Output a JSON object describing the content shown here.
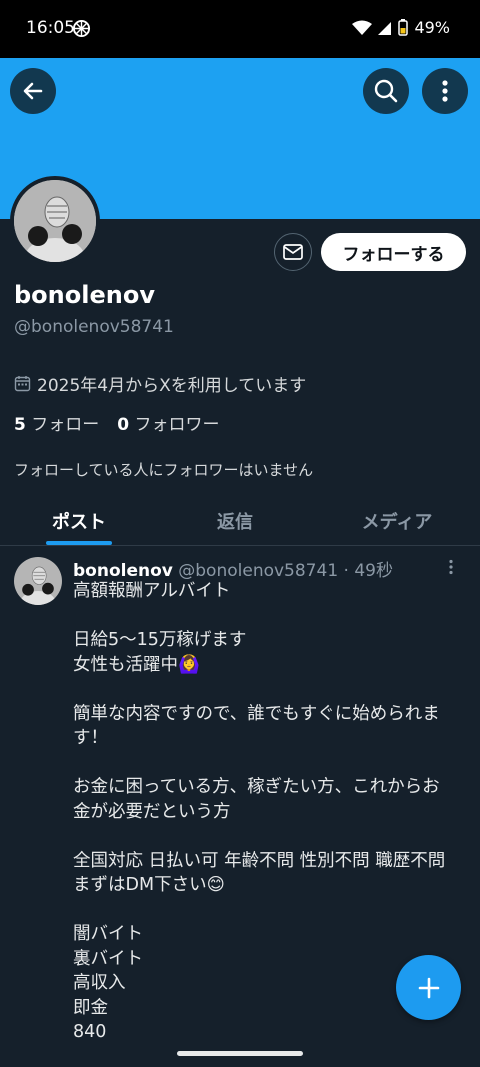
{
  "status_bar": {
    "time": "16:05",
    "battery": "49%"
  },
  "icons": {
    "back": "arrow-left-icon",
    "search": "search-icon",
    "more": "more-vertical-icon",
    "message": "envelope-icon",
    "calendar": "calendar-icon",
    "compose": "plus-icon"
  },
  "colors": {
    "banner": "#1da1f2",
    "background": "#15202b",
    "accent": "#1d9bf0"
  },
  "profile": {
    "display_name": "bonolenov",
    "handle": "@bonolenov58741",
    "joined": "2025年4月からXを利用しています",
    "following_count": "5",
    "following_label": "フォロー",
    "followers_count": "0",
    "followers_label": "フォロワー",
    "mutuals_note": "フォローしている人にフォロワーはいません",
    "follow_button": "フォローする"
  },
  "tabs": [
    {
      "label": "ポスト",
      "active": true
    },
    {
      "label": "返信",
      "active": false
    },
    {
      "label": "メディア",
      "active": false
    }
  ],
  "post": {
    "author_name": "bonolenov",
    "author_handle": "@bonolenov58741",
    "time_ago": "49秒",
    "lines": [
      "高額報酬アルバイト",
      "",
      "日給5〜15万稼げます",
      "女性も活躍中🙆‍♀️",
      "",
      "簡単な内容ですので、誰でもすぐに始められま",
      "す！",
      "",
      "お金に困っている方、稼ぎたい方、これからお",
      "金が必要だという方",
      "",
      "全国対応 日払い可 年齢不問 性別不問 職歴不問",
      "まずはDM下さい😊",
      "",
      "闇バイト",
      "裏バイト",
      "高収入",
      "即金",
      "840"
    ]
  }
}
